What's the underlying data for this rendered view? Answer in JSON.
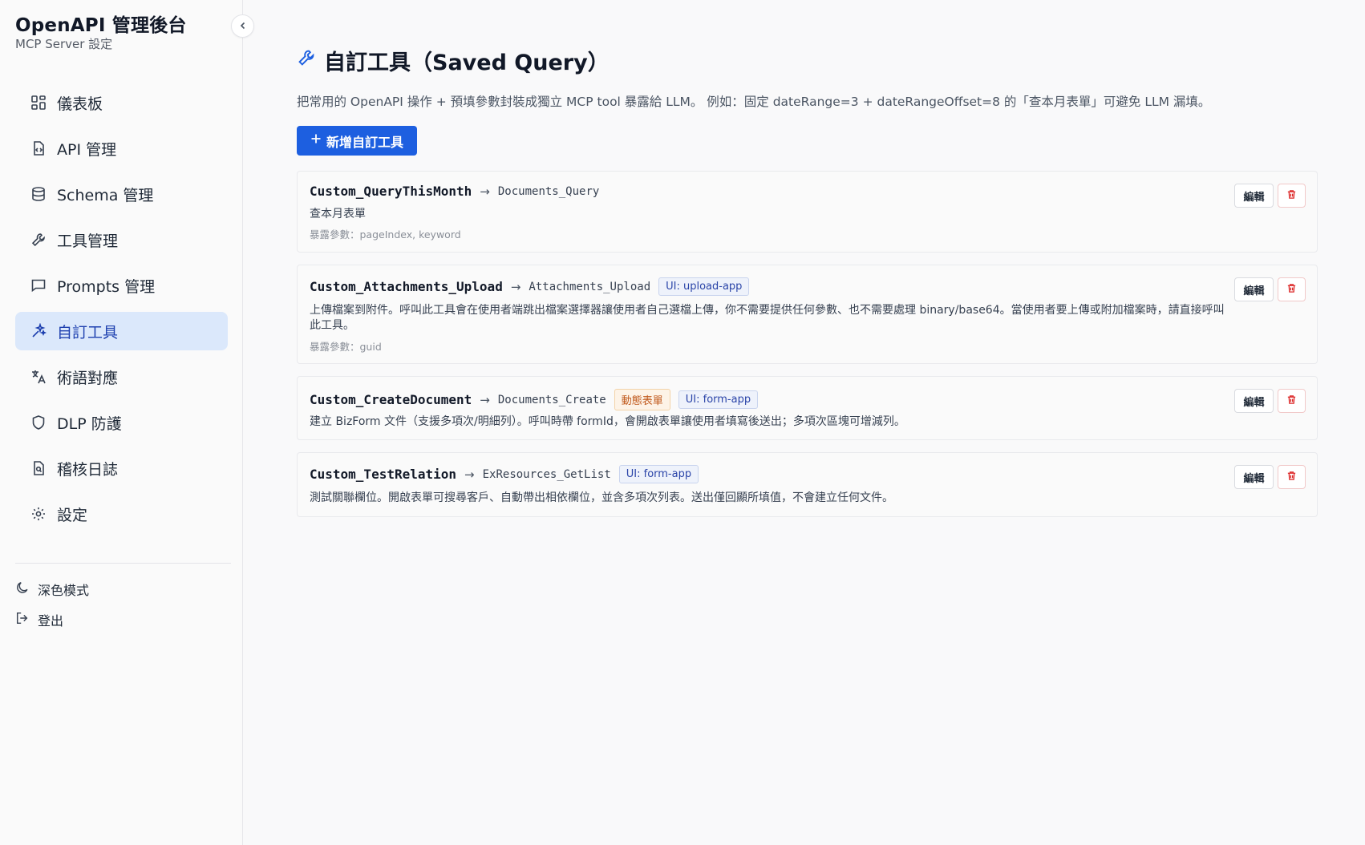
{
  "app": {
    "title": "OpenAPI 管理後台",
    "subtitle": "MCP Server 設定"
  },
  "sidebar": {
    "items": [
      {
        "label": "儀表板",
        "icon": "dashboard-icon"
      },
      {
        "label": "API 管理",
        "icon": "file-code-icon"
      },
      {
        "label": "Schema 管理",
        "icon": "database-icon"
      },
      {
        "label": "工具管理",
        "icon": "wrench-icon"
      },
      {
        "label": "Prompts 管理",
        "icon": "chat-icon"
      },
      {
        "label": "自訂工具",
        "icon": "sparkle-icon",
        "active": true
      },
      {
        "label": "術語對應",
        "icon": "translate-icon"
      },
      {
        "label": "DLP 防護",
        "icon": "shield-icon"
      },
      {
        "label": "稽核日誌",
        "icon": "file-search-icon"
      },
      {
        "label": "設定",
        "icon": "gear-icon"
      }
    ],
    "dark_mode": "深色模式",
    "logout": "登出"
  },
  "page": {
    "title": "自訂工具（Saved Query）",
    "description": "把常用的 OpenAPI 操作 + 預填參數封裝成獨立 MCP tool 暴露給 LLM。 例如：固定 dateRange=3 + dateRangeOffset=8 的「查本月表單」可避免 LLM 漏填。",
    "add_button": "新增自訂工具",
    "edit_label": "編輯"
  },
  "tools": [
    {
      "name": "Custom_QueryThisMonth",
      "arrow": "→",
      "target": "Documents_Query",
      "badges": [],
      "description": "查本月表單",
      "params": "暴露參數：pageIndex, keyword"
    },
    {
      "name": "Custom_Attachments_Upload",
      "arrow": "→",
      "target": "Attachments_Upload",
      "badges": [
        {
          "text": "UI: upload-app",
          "kind": "ui"
        }
      ],
      "description": "上傳檔案到附件。呼叫此工具會在使用者端跳出檔案選擇器讓使用者自己選檔上傳，你不需要提供任何參數、也不需要處理 binary/base64。當使用者要上傳或附加檔案時，請直接呼叫此工具。",
      "params": "暴露參數：guid"
    },
    {
      "name": "Custom_CreateDocument",
      "arrow": "→",
      "target": "Documents_Create",
      "badges": [
        {
          "text": "動態表單",
          "kind": "dyn"
        },
        {
          "text": "UI: form-app",
          "kind": "ui"
        }
      ],
      "description": "建立 BizForm 文件（支援多項次/明細列）。呼叫時帶 formId，會開啟表單讓使用者填寫後送出；多項次區塊可增減列。",
      "params": ""
    },
    {
      "name": "Custom_TestRelation",
      "arrow": "→",
      "target": "ExResources_GetList",
      "badges": [
        {
          "text": "UI: form-app",
          "kind": "ui"
        }
      ],
      "description": "測試關聯欄位。開啟表單可搜尋客戶、自動帶出相依欄位，並含多項次列表。送出僅回顯所填值，不會建立任何文件。",
      "params": ""
    }
  ],
  "colors": {
    "accent": "#1d5fe0",
    "active_bg": "#dbe8fb",
    "danger": "#dc2626"
  }
}
